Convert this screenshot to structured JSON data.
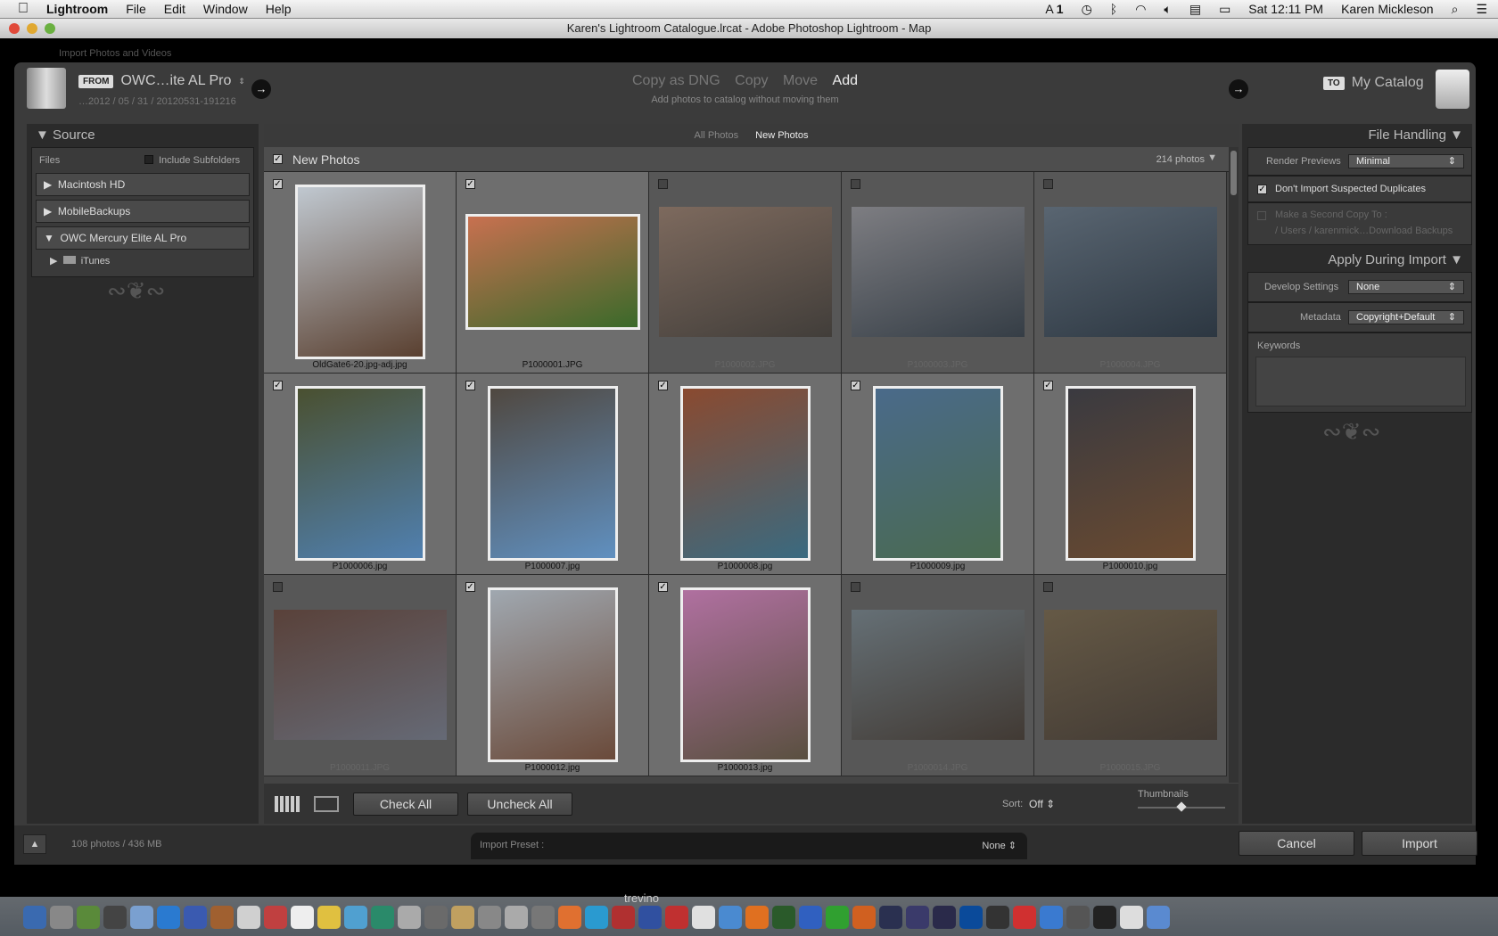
{
  "menubar": {
    "app": "Lightroom",
    "items": [
      "File",
      "Edit",
      "Window",
      "Help"
    ],
    "status": {
      "adobe": "1",
      "clock": "Sat 12:11 PM",
      "user": "Karen Mickleson"
    }
  },
  "window": {
    "title": "Karen's Lightroom Catalogue.lrcat - Adobe Photoshop Lightroom - Map",
    "behind_label": "Import Photos and Videos"
  },
  "header": {
    "from_badge": "FROM",
    "source_name": "OWC…ite AL Pro",
    "source_path": "…2012 / 05 / 31 / 20120531-191216",
    "modes": [
      "Copy as DNG",
      "Copy",
      "Move",
      "Add"
    ],
    "active_mode": "Add",
    "mode_desc": "Add photos to catalog without moving them",
    "to_badge": "TO",
    "dest_name": "My Catalog"
  },
  "source": {
    "title": "Source",
    "files_label": "Files",
    "include_subfolders": "Include Subfolders",
    "volumes": [
      "Macintosh HD",
      "MobileBackups",
      "OWC Mercury Elite AL Pro"
    ],
    "folder": "iTunes"
  },
  "grid": {
    "tabs": [
      "All Photos",
      "New Photos"
    ],
    "active_tab": "New Photos",
    "section_title": "New Photos",
    "count": "214 photos",
    "photos": [
      {
        "name": "OldGate6-20.jpg-adj.jpg",
        "checked": true,
        "portrait": true,
        "colors": [
          "#5a4030",
          "#c0c8d0"
        ]
      },
      {
        "name": "P1000001.JPG",
        "checked": true,
        "portrait": false,
        "colors": [
          "#3a6a2a",
          "#c87050"
        ]
      },
      {
        "name": "P1000002.JPG",
        "checked": false,
        "portrait": false,
        "colors": [
          "#3a3530",
          "#8a7060"
        ]
      },
      {
        "name": "P1000003.JPG",
        "checked": false,
        "portrait": false,
        "colors": [
          "#2a3540",
          "#8a8a90"
        ]
      },
      {
        "name": "P1000004.JPG",
        "checked": false,
        "portrait": false,
        "colors": [
          "#1e2c3a",
          "#5a6a7a"
        ]
      },
      {
        "name": "P1000006.jpg",
        "checked": true,
        "portrait": true,
        "colors": [
          "#5080b0",
          "#4a5030"
        ]
      },
      {
        "name": "P1000007.jpg",
        "checked": true,
        "portrait": true,
        "colors": [
          "#6090c0",
          "#504840"
        ]
      },
      {
        "name": "P1000008.jpg",
        "checked": true,
        "portrait": true,
        "colors": [
          "#3a6a80",
          "#8a4a30"
        ]
      },
      {
        "name": "P1000009.jpg",
        "checked": true,
        "portrait": true,
        "colors": [
          "#4a6a50",
          "#4a6a8a"
        ]
      },
      {
        "name": "P1000010.jpg",
        "checked": true,
        "portrait": true,
        "colors": [
          "#6a4a30",
          "#3a3a40"
        ]
      },
      {
        "name": "P1000011.JPG",
        "checked": false,
        "portrait": false,
        "colors": [
          "#6a7080",
          "#5a3a30"
        ]
      },
      {
        "name": "P1000012.jpg",
        "checked": true,
        "portrait": true,
        "colors": [
          "#6a4a3a",
          "#a0a8b0"
        ]
      },
      {
        "name": "P1000013.jpg",
        "checked": true,
        "portrait": true,
        "colors": [
          "#5a5040",
          "#b070a0"
        ]
      },
      {
        "name": "P1000014.JPG",
        "checked": false,
        "portrait": false,
        "colors": [
          "#3a3028",
          "#6a7880"
        ]
      },
      {
        "name": "P1000015.JPG",
        "checked": false,
        "portrait": false,
        "colors": [
          "#3a3028",
          "#6a5a40"
        ]
      }
    ]
  },
  "toolbar": {
    "check_all": "Check All",
    "uncheck_all": "Uncheck All",
    "sort_label": "Sort:",
    "sort_value": "Off",
    "thumbnails_label": "Thumbnails",
    "thumbnail_size": 0.5
  },
  "file_handling": {
    "title": "File Handling",
    "render_previews_label": "Render Previews",
    "render_previews_value": "Minimal",
    "no_duplicates": "Don't Import Suspected Duplicates",
    "no_duplicates_checked": true,
    "second_copy": "Make a Second Copy To :",
    "second_copy_path": "/ Users / karenmick…Download Backups"
  },
  "apply": {
    "title": "Apply During Import",
    "develop_label": "Develop Settings",
    "develop_value": "None",
    "metadata_label": "Metadata",
    "metadata_value": "Copyright+Default",
    "keywords_label": "Keywords"
  },
  "footer": {
    "summary": "108 photos / 436 MB",
    "preset_label": "Import Preset :",
    "preset_value": "None",
    "cancel": "Cancel",
    "import": "Import"
  },
  "dock": {
    "label": "trevino",
    "colors": [
      "#3a6ab0",
      "#888",
      "#5a8a3a",
      "#444",
      "#7aa0d0",
      "#2a7ad0",
      "#3a5ab0",
      "#a06030",
      "#d0d0d0",
      "#c04040",
      "#eee",
      "#e0c040",
      "#50a0d0",
      "#2a8a6a",
      "#aaa",
      "#6a6a6a",
      "#c0a060",
      "#888",
      "#aaa",
      "#777",
      "#e07030",
      "#2a9ad0",
      "#b03030",
      "#3050a0",
      "#c03030",
      "#e0e0e0",
      "#4a8ad0",
      "#e07020",
      "#2a5a2a",
      "#3060c0",
      "#30a030",
      "#d06020",
      "#2a3050",
      "#3a3a6a",
      "#2a2a4a",
      "#0a4a9a",
      "#333",
      "#d03030",
      "#3a7ad0",
      "#555",
      "#222",
      "#ddd",
      "#5a8ad0"
    ]
  }
}
